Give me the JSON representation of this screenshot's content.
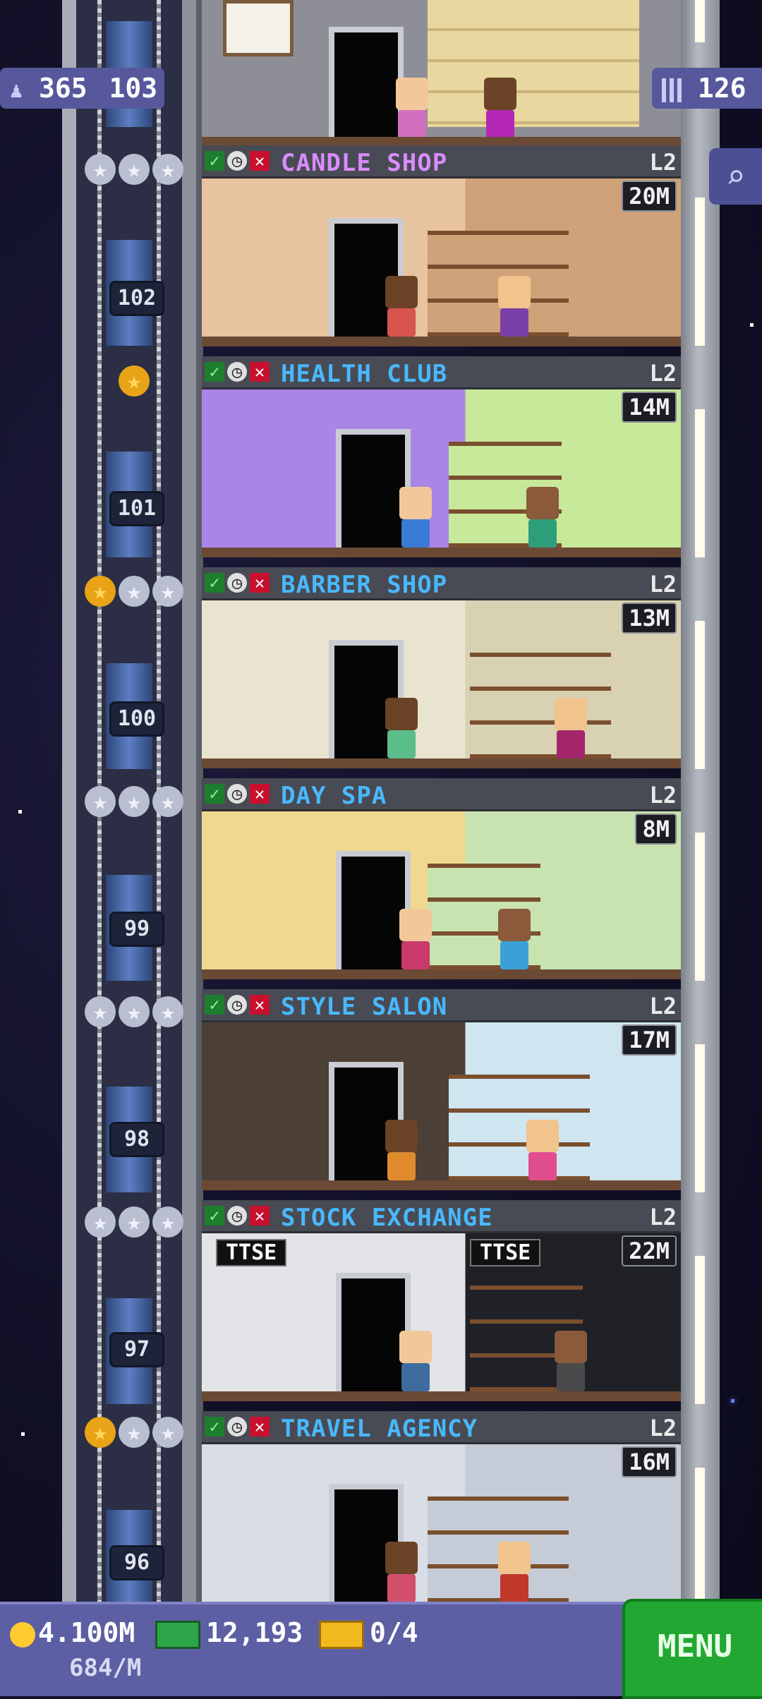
{
  "top_badges": {
    "population": "365",
    "floors": "126",
    "population_icon": "person-icon",
    "floors_icon": "building-icon"
  },
  "shaft": {
    "floor_numbers": [
      "103",
      "102",
      "101",
      "100",
      "99",
      "98",
      "97",
      "96"
    ]
  },
  "shops": [
    {
      "name": "CANDLE SHOP",
      "level": "L2",
      "stock": "20M",
      "name_color": "#d98cff",
      "stars_gold": 0,
      "stars_total": 3
    },
    {
      "name": "HEALTH CLUB",
      "level": "L2",
      "stock": "14M",
      "name_color": "#49b8ff",
      "stars_gold": 1,
      "stars_total": 1
    },
    {
      "name": "BARBER SHOP",
      "level": "L2",
      "stock": "13M",
      "name_color": "#49b8ff",
      "stars_gold": 1,
      "stars_total": 3
    },
    {
      "name": "DAY SPA",
      "level": "L2",
      "stock": "8M",
      "name_color": "#49b8ff",
      "stars_gold": 0,
      "stars_total": 3
    },
    {
      "name": "STYLE SALON",
      "level": "L2",
      "stock": "17M",
      "name_color": "#49b8ff",
      "stars_gold": 0,
      "stars_total": 3
    },
    {
      "name": "STOCK EXCHANGE",
      "level": "L2",
      "stock": "22M",
      "name_color": "#49b8ff",
      "stars_gold": 0,
      "stars_total": 3
    },
    {
      "name": "TRAVEL AGENCY",
      "level": "L2",
      "stock": "16M",
      "name_color": "#49b8ff",
      "stars_gold": 1,
      "stars_total": 3
    }
  ],
  "room_signs": {
    "ttse_left": "TTSE",
    "ttse_right": "TTSE"
  },
  "bottom_bar": {
    "coins": "4.100M",
    "coin_rate": "684/M",
    "bux": "12,193",
    "tickets": "0/4",
    "menu_label": "MENU"
  },
  "icons": {
    "search": "magnifier-icon",
    "check": "check-icon",
    "clock": "clock-icon",
    "cross": "cross-icon",
    "star": "star-icon"
  },
  "colors": {
    "background": "#100f25",
    "label_bar": "#484b54",
    "bottom_bar": "#5d5fa4",
    "menu_button": "#22a832"
  }
}
